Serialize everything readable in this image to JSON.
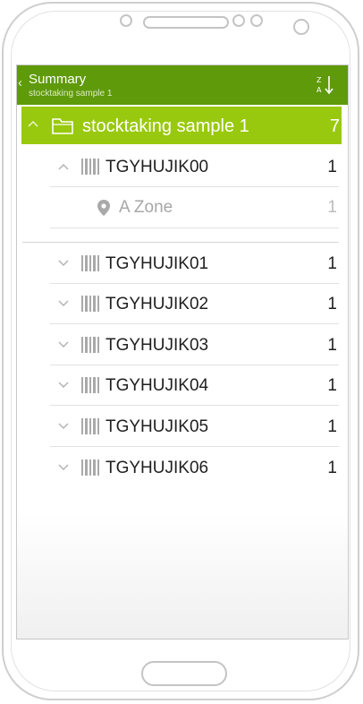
{
  "actionbar": {
    "title": "Summary",
    "subtitle": "stocktaking sample 1",
    "back_icon": "chevron-left-icon",
    "sort_icon": "sort-z-a-icon",
    "color": "#5f9a0a"
  },
  "group": {
    "label": "stocktaking sample 1",
    "count": "7",
    "icon": "folder-icon",
    "expanded": true,
    "color": "#99c90e"
  },
  "items": [
    {
      "label": "TGYHUJIK00",
      "count": "1",
      "expanded": true
    },
    {
      "label": "TGYHUJIK01",
      "count": "1",
      "expanded": false
    },
    {
      "label": "TGYHUJIK02",
      "count": "1",
      "expanded": false
    },
    {
      "label": "TGYHUJIK03",
      "count": "1",
      "expanded": false
    },
    {
      "label": "TGYHUJIK04",
      "count": "1",
      "expanded": false
    },
    {
      "label": "TGYHUJIK05",
      "count": "1",
      "expanded": false
    },
    {
      "label": "TGYHUJIK06",
      "count": "1",
      "expanded": false
    }
  ],
  "subitem": {
    "label": "A Zone",
    "count": "1",
    "icon": "location-pin-icon"
  }
}
